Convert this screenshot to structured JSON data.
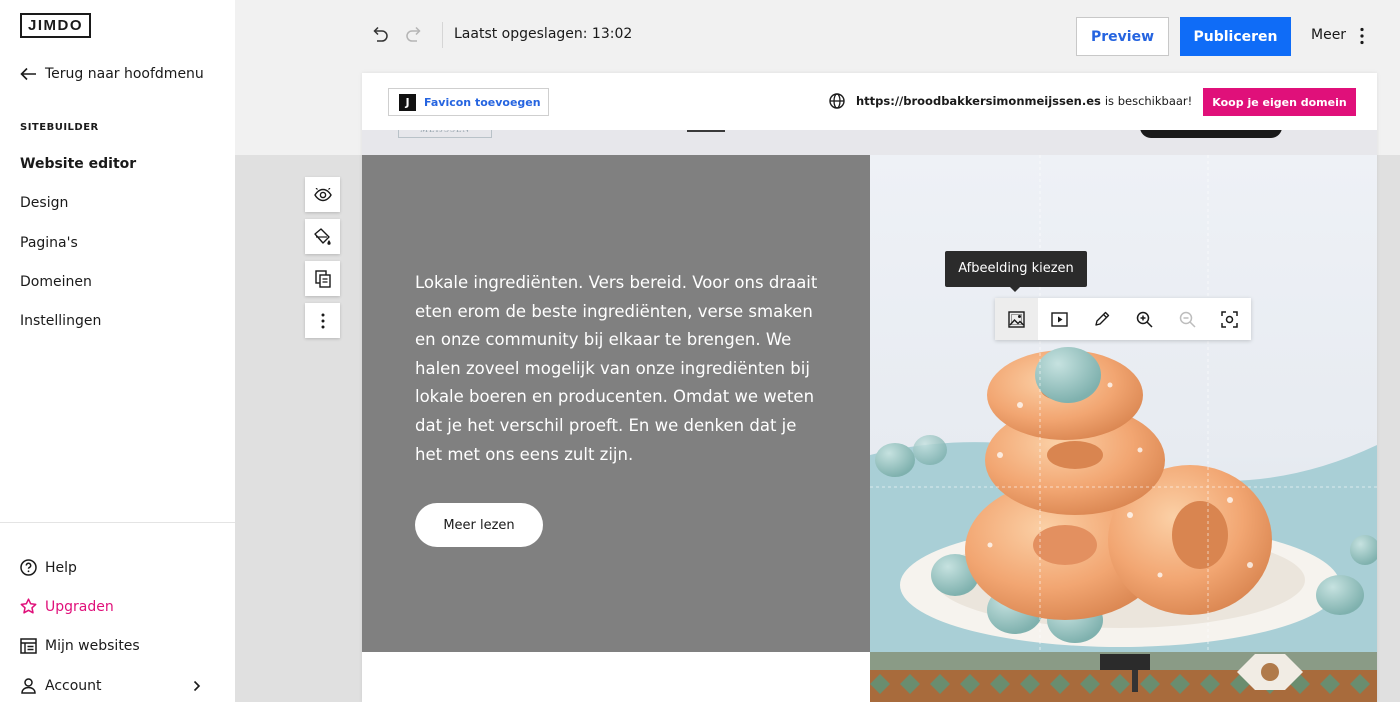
{
  "sidebar": {
    "logo": "JIMDO",
    "back_label": "Terug naar hoofdmenu",
    "section_label": "SITEBUILDER",
    "items": [
      {
        "label": "Website editor",
        "active": true
      },
      {
        "label": "Design"
      },
      {
        "label": "Pagina's"
      },
      {
        "label": "Domeinen"
      },
      {
        "label": "Instellingen"
      }
    ],
    "bottom": {
      "help": "Help",
      "upgrade": "Upgraden",
      "websites": "Mijn websites",
      "account": "Account"
    }
  },
  "topbar": {
    "saved_text": "Laatst opgeslagen: 13:02",
    "preview_label": "Preview",
    "publish_label": "Publiceren",
    "more_label": "Meer"
  },
  "banner": {
    "favicon_letter": "J",
    "favicon_label": "Favicon toevoegen",
    "domain_url": "https://broodbakkersimonmeijssen.es",
    "domain_status": "is beschikbaar!",
    "buy_label": "Koop je eigen domein"
  },
  "site": {
    "logo_text": "MEIJSSEN",
    "body_text": "Lokale ingrediënten. Vers bereid. Voor ons draait eten erom de beste ingrediënten, verse smaken en onze community bij elkaar te brengen. We halen zoveel mogelijk van onze ingrediënten bij lokale boeren en producenten. Omdat we weten dat je het verschil proeft. En we denken dat je het met ons eens zult zijn.",
    "read_more_label": "Meer lezen"
  },
  "image_toolbar": {
    "tooltip": "Afbeelding kiezen"
  },
  "colors": {
    "primary_blue": "#0f6cf7",
    "accent_pink": "#e0107a",
    "text_block_bg": "#808080"
  }
}
